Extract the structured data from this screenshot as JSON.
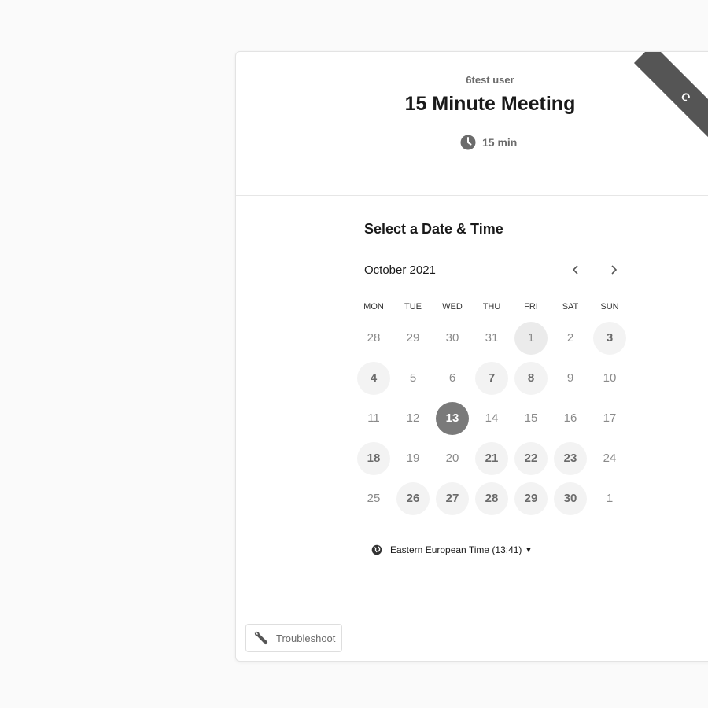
{
  "header": {
    "host_name": "6test user",
    "event_title": "15 Minute Meeting",
    "duration": "15 min",
    "ribbon_text": "C"
  },
  "calendar": {
    "section_title": "Select a Date & Time",
    "month_label": "October 2021",
    "prev_icon": "chevron-left-icon",
    "next_icon": "chevron-right-icon",
    "weekdays": [
      "MON",
      "TUE",
      "WED",
      "THU",
      "FRI",
      "SAT",
      "SUN"
    ],
    "days": [
      {
        "label": "28",
        "state": "outside"
      },
      {
        "label": "29",
        "state": "outside"
      },
      {
        "label": "30",
        "state": "outside"
      },
      {
        "label": "31",
        "state": "outside"
      },
      {
        "label": "1",
        "state": "today"
      },
      {
        "label": "2",
        "state": "unavailable"
      },
      {
        "label": "3",
        "state": "available"
      },
      {
        "label": "4",
        "state": "available"
      },
      {
        "label": "5",
        "state": "unavailable"
      },
      {
        "label": "6",
        "state": "unavailable"
      },
      {
        "label": "7",
        "state": "available"
      },
      {
        "label": "8",
        "state": "available"
      },
      {
        "label": "9",
        "state": "unavailable"
      },
      {
        "label": "10",
        "state": "unavailable"
      },
      {
        "label": "11",
        "state": "unavailable"
      },
      {
        "label": "12",
        "state": "unavailable"
      },
      {
        "label": "13",
        "state": "selected"
      },
      {
        "label": "14",
        "state": "unavailable"
      },
      {
        "label": "15",
        "state": "unavailable"
      },
      {
        "label": "16",
        "state": "unavailable"
      },
      {
        "label": "17",
        "state": "unavailable"
      },
      {
        "label": "18",
        "state": "available"
      },
      {
        "label": "19",
        "state": "unavailable"
      },
      {
        "label": "20",
        "state": "unavailable"
      },
      {
        "label": "21",
        "state": "available"
      },
      {
        "label": "22",
        "state": "available"
      },
      {
        "label": "23",
        "state": "available"
      },
      {
        "label": "24",
        "state": "unavailable"
      },
      {
        "label": "25",
        "state": "unavailable"
      },
      {
        "label": "26",
        "state": "available"
      },
      {
        "label": "27",
        "state": "available"
      },
      {
        "label": "28",
        "state": "available"
      },
      {
        "label": "29",
        "state": "available"
      },
      {
        "label": "30",
        "state": "available"
      },
      {
        "label": "1",
        "state": "outside"
      }
    ]
  },
  "timezone": {
    "label": "Eastern European Time (13:41)",
    "icon": "globe-icon"
  },
  "troubleshoot": {
    "label": "Troubleshoot",
    "icon": "wrench-icon"
  },
  "colors": {
    "selected": "#7a7a7a",
    "available_bg": "#f3f3f3",
    "ribbon": "#555555"
  }
}
